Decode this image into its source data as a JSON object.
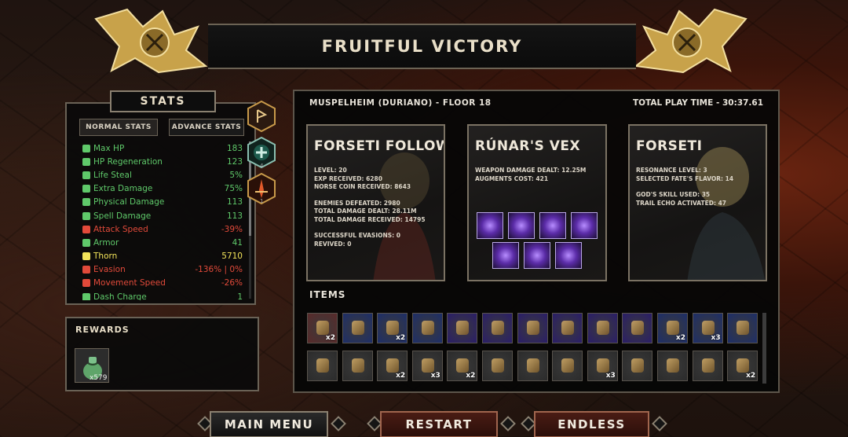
{
  "header": {
    "title": "FRUITFUL VICTORY"
  },
  "stats": {
    "title": "STATS",
    "tabs": {
      "normal": "NORMAL STATS",
      "advance": "ADVANCE STATS"
    },
    "rows": [
      {
        "label": "Max HP",
        "value": "183",
        "color": "#5fc96a"
      },
      {
        "label": "HP Regeneration",
        "value": "123",
        "color": "#5fc96a"
      },
      {
        "label": "Life Steal",
        "value": "5%",
        "color": "#5fc96a"
      },
      {
        "label": "Extra Damage",
        "value": "75%",
        "color": "#5fc96a"
      },
      {
        "label": "Physical Damage",
        "value": "113",
        "color": "#5fc96a"
      },
      {
        "label": "Spell Damage",
        "value": "113",
        "color": "#5fc96a"
      },
      {
        "label": "Attack Speed",
        "value": "-39%",
        "color": "#e24a3a"
      },
      {
        "label": "Armor",
        "value": "41",
        "color": "#5fc96a"
      },
      {
        "label": "Thorn",
        "value": "5710",
        "color": "#f3e45a"
      },
      {
        "label": "Evasion",
        "value": "-136% | 0%",
        "color": "#e24a3a"
      },
      {
        "label": "Movement Speed",
        "value": "-26%",
        "color": "#e24a3a"
      },
      {
        "label": "Dash Charge",
        "value": "1",
        "color": "#5fc96a"
      }
    ],
    "side_buttons": [
      {
        "icon": "rune-icon",
        "count": ""
      },
      {
        "icon": "heal-cross-icon",
        "count": "4"
      },
      {
        "icon": "flame-sword-icon",
        "count": "1"
      }
    ]
  },
  "rewards": {
    "title": "REWARDS",
    "count": "x579",
    "icon": "coin-sack-icon"
  },
  "run": {
    "location": "MUSPELHEIM (DURIANO) - FLOOR 18",
    "playtime": "TOTAL PLAY TIME - 30:37.61"
  },
  "cards": [
    {
      "title": "FORSETI FOLLOWER",
      "lines": [
        "LEVEL: 20",
        "EXP RECEIVED: 6280",
        "NORSE COIN RECEIVED: 8643",
        "",
        "ENEMIES DEFEATED: 2980",
        "TOTAL DAMAGE DEALT: 28.11M",
        "TOTAL DAMAGE RECEIVED: 14795",
        "",
        "SUCCESSFUL EVASIONS: 0",
        "REVIVED: 0"
      ]
    },
    {
      "title": "RÚNAR'S VEX",
      "lines": [
        "WEAPON DAMAGE DEALT: 12.25M",
        "AUGMENTS COST: 421"
      ]
    },
    {
      "title": "FORSETI",
      "lines": [
        "RESONANCE LEVEL: 3",
        "SELECTED FATE'S FLAVOR: 14",
        "",
        "GOD'S SKILL USED: 35",
        "TRAIL ECHO ACTIVATED: 47"
      ]
    }
  ],
  "augments": [
    "claw-augment-icon",
    "wing-augment-icon",
    "shield-augment-icon",
    "vortex-augment-icon",
    "orb-augment-icon",
    "crystal-augment-icon",
    "lightning-augment-icon"
  ],
  "items": {
    "title": "ITEMS",
    "row1": [
      {
        "icon": "pig-charm-icon",
        "count": "x2",
        "frame": "#5a2a2a"
      },
      {
        "icon": "crystal-bag-icon",
        "count": "",
        "frame": "#1d2e6a"
      },
      {
        "icon": "chest-icon",
        "count": "x2",
        "frame": "#1d2e6a"
      },
      {
        "icon": "horn-icon",
        "count": "",
        "frame": "#1d2e6a"
      },
      {
        "icon": "ring-icon",
        "count": "",
        "frame": "#2a1d6a"
      },
      {
        "icon": "helmet-icon",
        "count": "",
        "frame": "#2a1d6a"
      },
      {
        "icon": "wings-icon",
        "count": "",
        "frame": "#2a1d6a"
      },
      {
        "icon": "crown-icon",
        "count": "",
        "frame": "#2a1d6a"
      },
      {
        "icon": "ice-shard-icon",
        "count": "",
        "frame": "#2a1d6a"
      },
      {
        "icon": "purple-shard-icon",
        "count": "",
        "frame": "#2a1d6a"
      },
      {
        "icon": "scroll-icon",
        "count": "x2",
        "frame": "#1d2e6a"
      },
      {
        "icon": "bow-icon",
        "count": "x3",
        "frame": "#1d2e6a"
      },
      {
        "icon": "mask-icon",
        "count": "",
        "frame": "#1d2e6a"
      }
    ],
    "row2": [
      {
        "icon": "gold-coin-icon",
        "count": "",
        "frame": "#2b2b2b"
      },
      {
        "icon": "spider-icon",
        "count": "",
        "frame": "#2b2b2b"
      },
      {
        "icon": "axe-icon",
        "count": "x2",
        "frame": "#2b2b2b"
      },
      {
        "icon": "gauntlet-icon",
        "count": "x3",
        "frame": "#2b2b2b"
      },
      {
        "icon": "gold-horn-icon",
        "count": "x2",
        "frame": "#2b2b2b"
      },
      {
        "icon": "lantern-icon",
        "count": "",
        "frame": "#2b2b2b"
      },
      {
        "icon": "red-claw-icon",
        "count": "",
        "frame": "#2b2b2b"
      },
      {
        "icon": "gold-helm-icon",
        "count": "",
        "frame": "#2b2b2b"
      },
      {
        "icon": "dagger-icon",
        "count": "x3",
        "frame": "#2b2b2b"
      },
      {
        "icon": "armor-icon",
        "count": "",
        "frame": "#2b2b2b"
      },
      {
        "icon": "potion-icon",
        "count": "",
        "frame": "#2b2b2b"
      },
      {
        "icon": "book-icon",
        "count": "",
        "frame": "#2b2b2b"
      },
      {
        "icon": "hammer-icon",
        "count": "x2",
        "frame": "#2b2b2b"
      }
    ]
  },
  "buttons": {
    "main_menu": "MAIN MENU",
    "restart": "RESTART",
    "endless": "ENDLESS"
  }
}
